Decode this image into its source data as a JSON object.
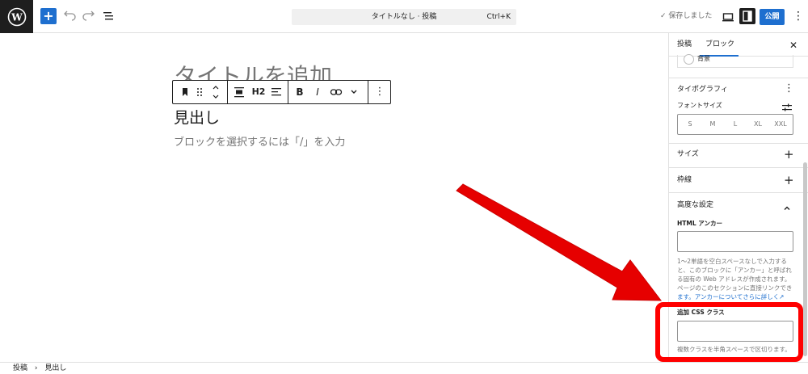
{
  "colors": {
    "accent": "#1e6fcf",
    "annotation": "#ff0000",
    "dark": "#1e1e1e"
  },
  "topbar": {
    "inserter_icon": "+",
    "undo_icon": "undo-icon",
    "redo_icon": "redo-icon",
    "outline_icon": "list-view-icon",
    "document_title": "タイトルなし · 投稿",
    "shortcut": "Ctrl+K",
    "saved_status": "✓ 保存しました",
    "publish_label": "公開",
    "options_icon": "⋮"
  },
  "editor": {
    "title_placeholder": "タイトルを追加",
    "heading_text": "見出し",
    "paragraph_placeholder": "ブロックを選択するには「/」を入力",
    "toolbar": {
      "heading_level": "H2",
      "bold": "B",
      "italic": "I",
      "more": "⋮"
    }
  },
  "sidebar": {
    "tabs": [
      {
        "label": "投稿"
      },
      {
        "label": "ブロック"
      }
    ],
    "active_tab": "ブロック",
    "close_icon": "✕",
    "background_label": "背景",
    "typography": {
      "title": "タイポグラフィ",
      "font_size_label": "フォントサイズ",
      "font_sizes": [
        "S",
        "M",
        "L",
        "XL",
        "XXL"
      ]
    },
    "size_title": "サイズ",
    "border_title": "枠線",
    "advanced": {
      "title": "高度な設定",
      "html_anchor_label": "HTML アンカー",
      "html_anchor_value": "",
      "anchor_help_line1": "1〜2単語を空白スペースなしで入力する",
      "anchor_help_line2": "と、このブロックに「アンカー」と呼ばれ",
      "anchor_help_line3": "る固有の Web アドレスが作成されます。",
      "anchor_help_line4": "ページのこのセクションに直接リンクでき",
      "anchor_help_line5": "ます。アンカーについてさらに詳しく↗",
      "css_class_label": "追加 CSS クラス",
      "css_class_value": "",
      "css_help": "複数クラスを半角スペースで区切ります。"
    }
  },
  "breadcrumb": {
    "root": "投稿",
    "separator": "›",
    "current": "見出し"
  }
}
